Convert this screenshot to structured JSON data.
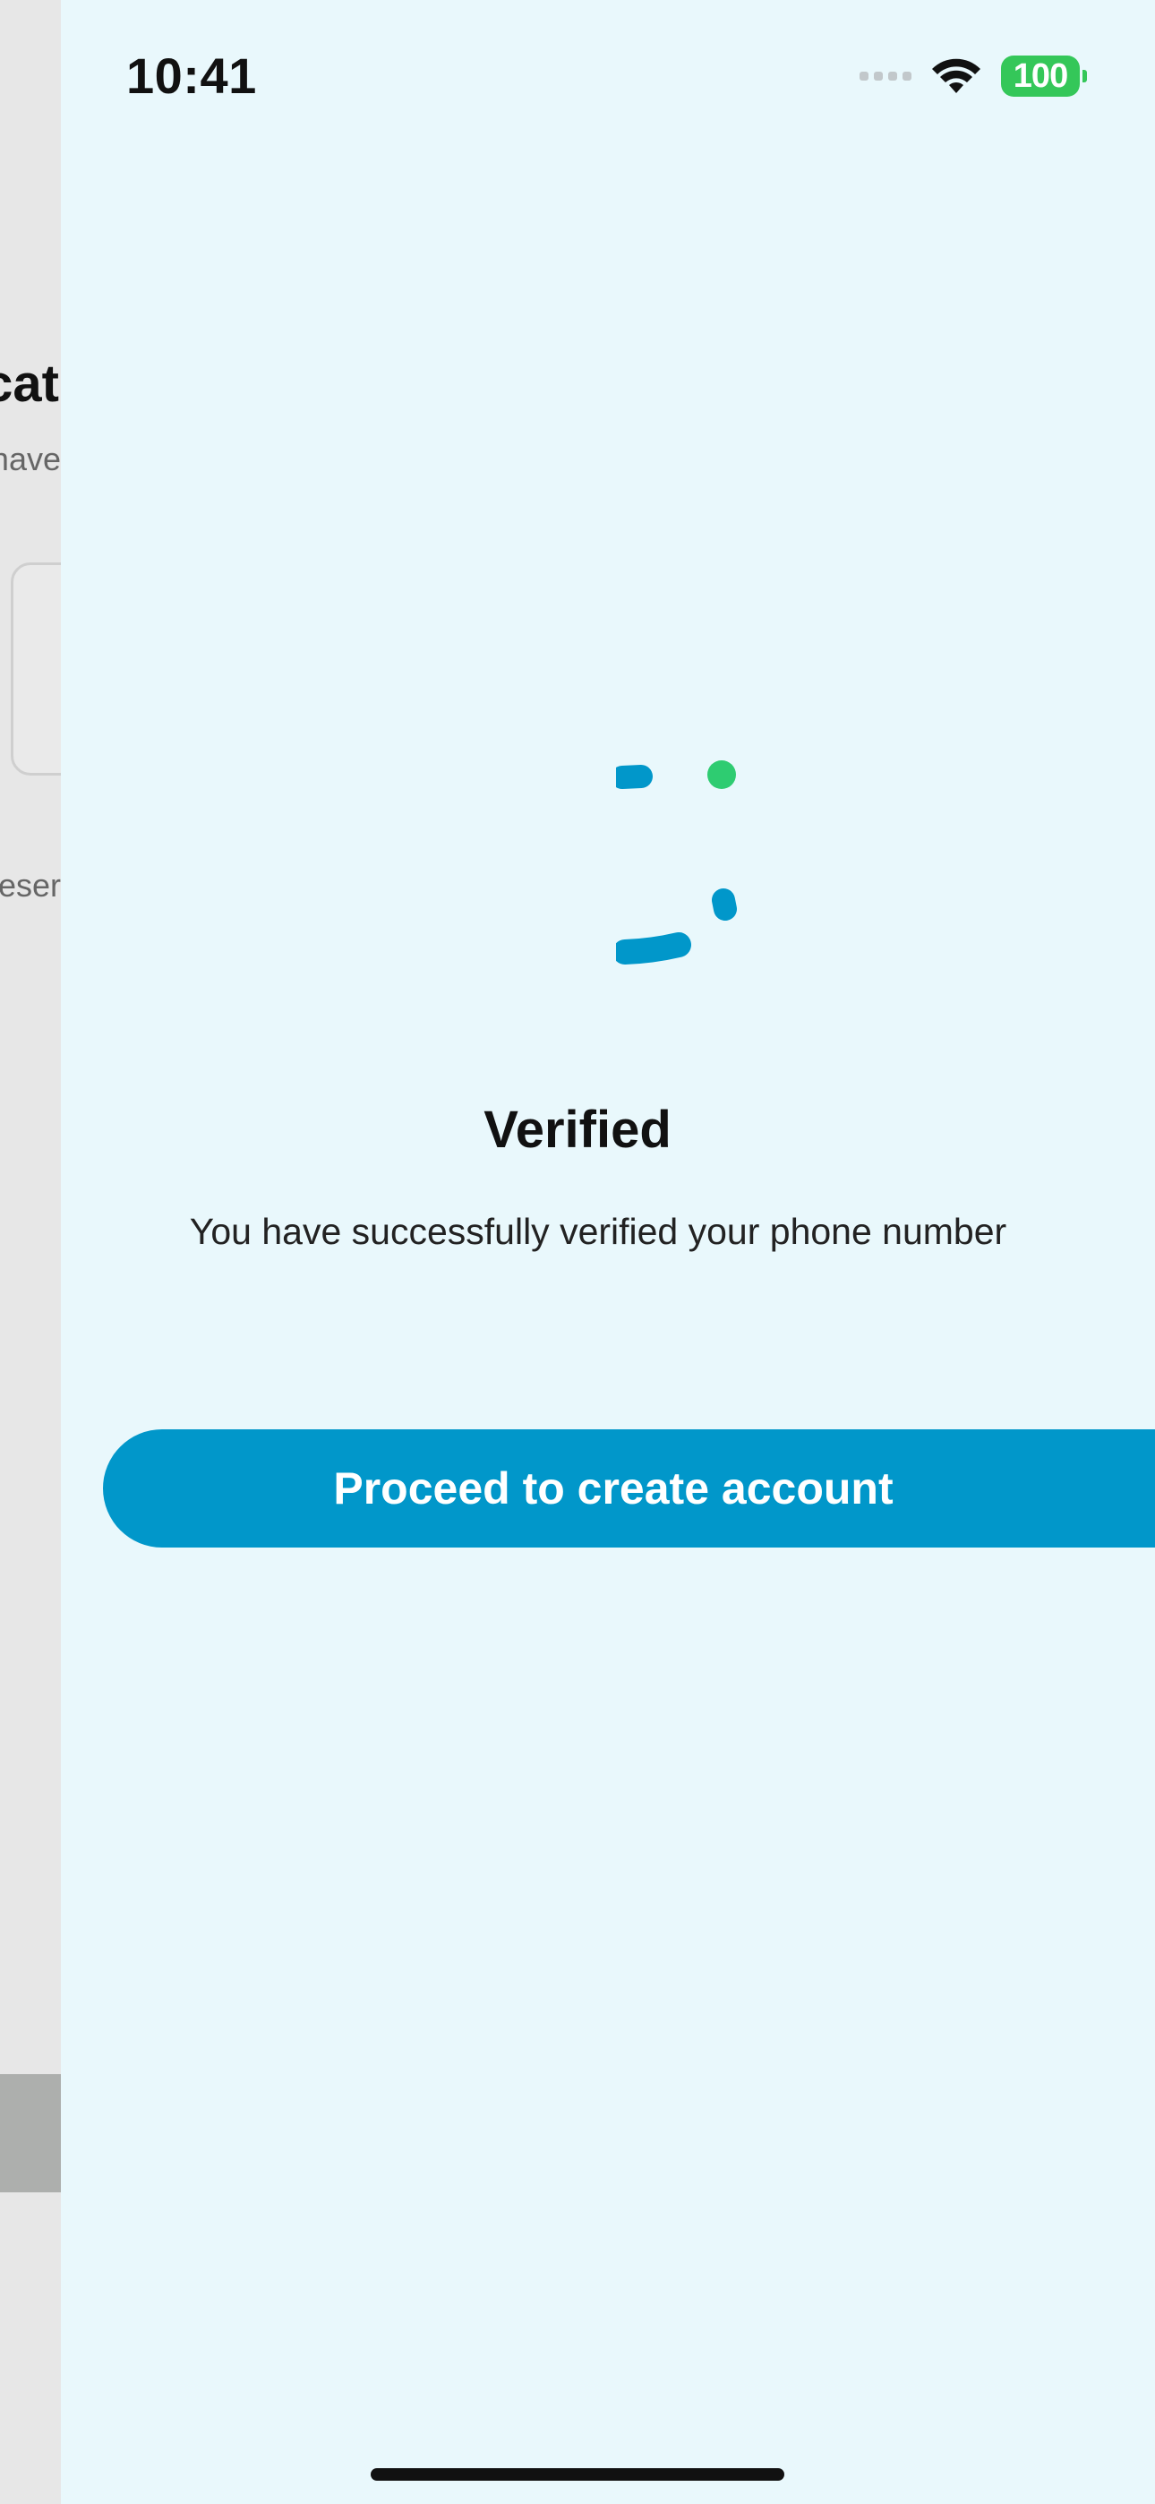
{
  "status_bar": {
    "time": "10:41",
    "battery": "100"
  },
  "background_screen": {
    "title_fragment": "cat",
    "subtitle_fragment": "have",
    "resend_fragment": "eser"
  },
  "verification": {
    "title": "Verified",
    "message": "You have successfully verified your phone number"
  },
  "actions": {
    "proceed_label": "Proceed to create account"
  },
  "colors": {
    "sheet_background": "#e9f8fc",
    "accent": "#0197ca",
    "success": "#34c759",
    "spinner_dot": "#2ecc71"
  }
}
